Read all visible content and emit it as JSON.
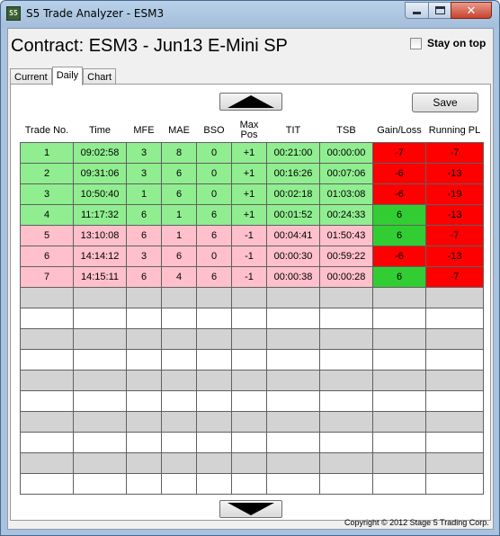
{
  "window": {
    "app_icon": "S5",
    "title": "S5 Trade Analyzer - ESM3"
  },
  "header": {
    "contract": "Contract: ESM3 - Jun13 E-Mini SP",
    "stay_on_top": "Stay on top",
    "stay_on_top_checked": false
  },
  "tabs": [
    {
      "label": "Current",
      "active": false
    },
    {
      "label": "Daily",
      "active": true
    },
    {
      "label": "Chart",
      "active": false
    }
  ],
  "toolbar": {
    "save_label": "Save",
    "scroll_up_icon": "triangle-up-icon",
    "scroll_down_icon": "triangle-down-icon"
  },
  "table": {
    "columns": [
      "Trade No.",
      "Time",
      "MFE",
      "MAE",
      "BSO",
      "Max\nPos",
      "TIT",
      "TSB",
      "Gain/Loss",
      "Running PL"
    ],
    "rows": [
      [
        "1",
        "09:02:58",
        "3",
        "8",
        "0",
        "+1",
        "00:21:00",
        "00:00:00",
        "-7",
        "-7"
      ],
      [
        "2",
        "09:31:06",
        "3",
        "6",
        "0",
        "+1",
        "00:16:26",
        "00:07:06",
        "-6",
        "-13"
      ],
      [
        "3",
        "10:50:40",
        "1",
        "6",
        "0",
        "+1",
        "00:02:18",
        "01:03:08",
        "-6",
        "-19"
      ],
      [
        "4",
        "11:17:32",
        "6",
        "1",
        "6",
        "+1",
        "00:01:52",
        "00:24:33",
        "6",
        "-13"
      ],
      [
        "5",
        "13:10:08",
        "6",
        "1",
        "6",
        "-1",
        "00:04:41",
        "01:50:43",
        "6",
        "-7"
      ],
      [
        "6",
        "14:14:12",
        "3",
        "6",
        "0",
        "-1",
        "00:00:30",
        "00:59:22",
        "-6",
        "-13"
      ],
      [
        "7",
        "14:15:11",
        "6",
        "4",
        "6",
        "-1",
        "00:00:38",
        "00:00:28",
        "6",
        "-7"
      ]
    ],
    "row_colors": {
      "long": "#90ee90",
      "short": "#ffc0cb",
      "gain": "#32cd32",
      "loss": "#ff0000"
    }
  },
  "footer": {
    "copyright": "Copyright © 2012 Stage 5 Trading Corp."
  }
}
